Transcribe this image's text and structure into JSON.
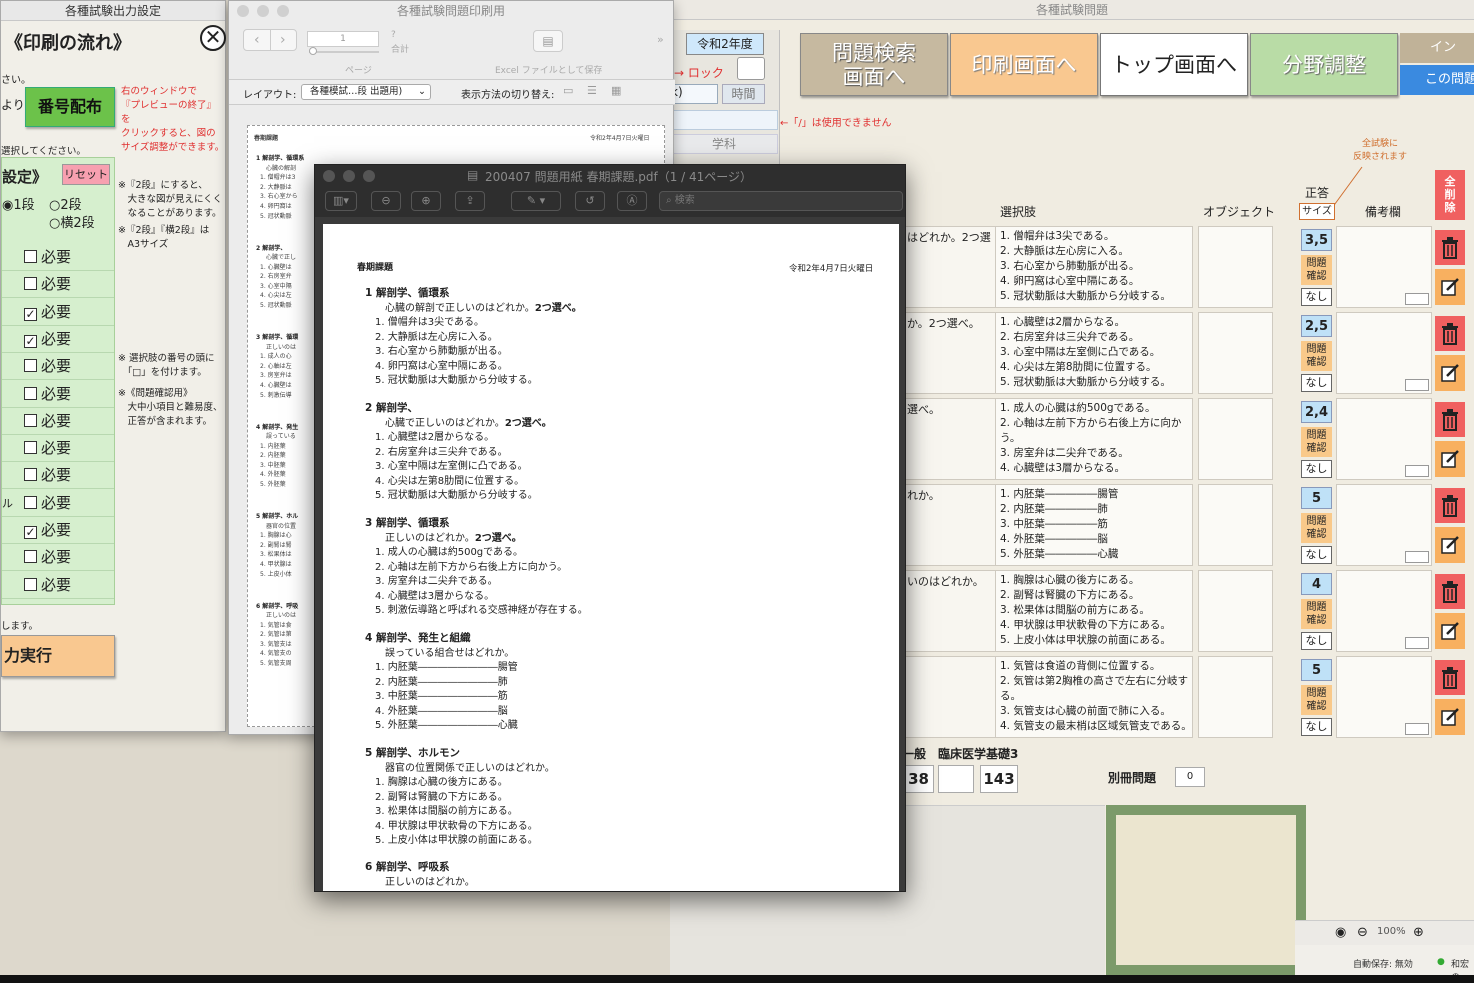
{
  "main_window": {
    "title": "各種試験問題",
    "buttons": {
      "search": "問題検索\n画面へ",
      "print": "印刷画面へ",
      "top": "トップ画面へ",
      "field": "分野調整",
      "partial_top": "イン",
      "partial_bottom": "この問題"
    },
    "year": "令和2年度",
    "lock_label": "ロック",
    "time_label": "時間",
    "subject_label": "学科",
    "partial_tab": "k)",
    "slash_warning": "←「/」は使用できません",
    "all_exam_note": "全試験に\n反映されます",
    "columns": {
      "choices": "選択肢",
      "object": "オブジェクト",
      "answer": "正答",
      "size": "サイズ",
      "remarks": "備考欄",
      "delete_all": "全\n削\n除"
    },
    "confirm_label": "問題\n確認",
    "none_label": "なし",
    "rows": [
      {
        "q": "はどれか。2つ選",
        "choices": [
          "1. 僧帽弁は3尖である。",
          "2. 大静脈は左心房に入る。",
          "3. 右心室から肺動脈が出る。",
          "4. 卵円窩は心室中隔にある。",
          "5. 冠状動脈は大動脈から分岐する。"
        ],
        "answer": "3,5"
      },
      {
        "q": "か。2つ選べ。",
        "choices": [
          "1. 心臓壁は2層からなる。",
          "2. 右房室弁は三尖弁である。",
          "3. 心室中隔は左室側に凸である。",
          "4. 心尖は左第8肋間に位置する。",
          "5. 冠状動脈は大動脈から分岐する。"
        ],
        "answer": "2,5"
      },
      {
        "q": "選べ。",
        "choices": [
          "1. 成人の心臓は約500gである。",
          "2. 心軸は左前下方から右後上方に向か",
          "う。",
          "3. 房室弁は二尖弁である。",
          "4. 心臓壁は3層からなる。"
        ],
        "answer": "2,4"
      },
      {
        "q": "れか。",
        "choices": [
          "1. 内胚葉―――――腸管",
          "2. 内胚葉―――――肺",
          "3. 中胚葉―――――筋",
          "4. 外胚葉―――――脳",
          "5. 外胚葉―――――心臓"
        ],
        "answer": "5"
      },
      {
        "q": "いのはどれか。",
        "choices": [
          "1. 胸腺は心臓の後方にある。",
          "2. 副腎は腎臓の下方にある。",
          "3. 松果体は間脳の前方にある。",
          "4. 甲状腺は甲状軟骨の下方にある。",
          "5. 上皮小体は甲状腺の前面にある。"
        ],
        "answer": "4"
      },
      {
        "q": "",
        "choices": [
          "1. 気管は食道の背側に位置する。",
          "2. 気管は第2胸椎の高さで左右に分岐す",
          "る。",
          "3. 気管支は心臓の前面で肺に入る。",
          "4. 気管支の最末梢は区域気管支である。"
        ],
        "answer": "5"
      }
    ],
    "footer": {
      "category_prefix": "一般",
      "category": "臨床医学基礎3",
      "num1": "38",
      "num2": "",
      "num3": "143",
      "extra_label": "別冊問題",
      "extra_value": "0"
    },
    "status": {
      "zoom": "100%",
      "autosave": "自動保存: 無効",
      "user": "和宏の"
    }
  },
  "left_window": {
    "title": "各種試験出力設定",
    "heading": "《印刷の流れ》",
    "text1": "さい。",
    "assign_prefix": "より",
    "assign_button": "番号配布",
    "red_note": "右のウィンドウで\n『プレビューの終了』を\nクリックすると、図の\nサイズ調整ができます。",
    "select_text": "選択してください。",
    "section_label": "設定》",
    "reset": "リセット",
    "radio_1": "1段",
    "radio_2": "2段",
    "radio_3": "横2段",
    "note1": "※『2段』にすると、\n　大きな図が見えにくく\n　なることがあります。",
    "note2": "※『2段』『横2段』は\n　A3サイズ",
    "note3": "※ 選択肢の番号の頭に\n　「□」を付けます。",
    "note4": "※《問題確認用》\n　大中小項目と難易度、\n　正答が含まれます。",
    "need_label": "必要",
    "checks": [
      false,
      false,
      true,
      true,
      false,
      false,
      false,
      false,
      false,
      false,
      true,
      false,
      false
    ],
    "row_prefix": [
      "",
      "",
      "",
      "",
      "",
      "",
      "",
      "",
      "",
      "ル",
      "",
      "",
      ""
    ],
    "bottom_text": "します。",
    "exec_button": "力実行"
  },
  "print_window": {
    "title": "各種試験問題印刷用",
    "page_value": "1",
    "page_total": "?",
    "total_label": "合計",
    "page_label": "ページ",
    "excel_label": "Excel ファイルとして保存",
    "layout_label": "レイアウト:",
    "layout_value": "各種模試…段 出題用)",
    "view_label": "表示方法の切り替え:",
    "preview_header_left": "春期課題",
    "preview_header_right": "令和2年4月7日火曜日",
    "preview": [
      [
        "1 解剖学、循環系",
        "心臓の解剖",
        "1. 僧帽弁は3",
        "2. 大静脈は",
        "3. 右心室から",
        "4. 卵円窩は",
        "5. 冠状動脈"
      ],
      [
        "2 解剖学、",
        "心臓で正し",
        "1. 心臓壁は",
        "2. 右房室弁",
        "3. 心室中隔",
        "4. 心尖は左",
        "5. 冠状動脈"
      ],
      [
        "3 解剖学、循環",
        "正しいのは",
        "1. 成人の心",
        "2. 心軸は左",
        "3. 房室弁は",
        "4. 心臓壁は",
        "5. 刺激伝導"
      ],
      [
        "4 解剖学、発生",
        "誤っている",
        "1. 内胚葉",
        "2. 内胚葉",
        "3. 中胚葉",
        "4. 外胚葉",
        "5. 外胚葉"
      ],
      [
        "5 解剖学、ホル",
        "器官の位置",
        "1. 胸腺は心",
        "2. 副腎は腎",
        "3. 松果体は",
        "4. 甲状腺は",
        "5. 上皮小体"
      ],
      [
        "6 解剖学、呼吸",
        "正しいのは",
        "1. 気管は食",
        "2. 気管は第",
        "3. 気管支は",
        "4. 気管支の",
        "5. 気管支周"
      ]
    ]
  },
  "pdf_window": {
    "title": "200407 問題用紙 春期課題.pdf（1 / 41ページ）",
    "search_placeholder": "検索",
    "header_left": "春期課題",
    "header_right": "令和2年4月7日火曜日",
    "questions": [
      {
        "h": "1 解剖学、循環系",
        "s": "心臓の解剖で正しいのはどれか。",
        "b": "2つ選べ。",
        "c": [
          "1. 僧帽弁は3尖である。",
          "2. 大静脈は左心房に入る。",
          "3. 右心室から肺動脈が出る。",
          "4. 卵円窩は心室中隔にある。",
          "5. 冠状動脈は大動脈から分岐する。"
        ]
      },
      {
        "h": "2 解剖学、",
        "s": "心臓で正しいのはどれか。",
        "b": "2つ選べ。",
        "c": [
          "1. 心臓壁は2層からなる。",
          "2. 右房室弁は三尖弁である。",
          "3. 心室中隔は左室側に凸である。",
          "4. 心尖は左第8肋間に位置する。",
          "5. 冠状動脈は大動脈から分岐する。"
        ]
      },
      {
        "h": "3 解剖学、循環系",
        "s": "正しいのはどれか。",
        "b": "2つ選べ。",
        "c": [
          "1. 成人の心臓は約500gである。",
          "2. 心軸は左前下方から右後上方に向かう。",
          "3. 房室弁は二尖弁である。",
          "4. 心臓壁は3層からなる。",
          "5. 刺激伝導路と呼ばれる交感神経が存在する。"
        ]
      },
      {
        "h": "4 解剖学、発生と組織",
        "s": "誤っている組合せはどれか。",
        "b": "",
        "c": [
          "1. 内胚葉――――――――腸管",
          "2. 内胚葉――――――――肺",
          "3. 中胚葉――――――――筋",
          "4. 外胚葉――――――――脳",
          "5. 外胚葉――――――――心臓"
        ]
      },
      {
        "h": "5 解剖学、ホルモン",
        "s": "器官の位置関係で正しいのはどれか。",
        "b": "",
        "c": [
          "1. 胸腺は心臓の後方にある。",
          "2. 副腎は腎臓の下方にある。",
          "3. 松果体は間脳の前方にある。",
          "4. 甲状腺は甲状軟骨の下方にある。",
          "5. 上皮小体は甲状腺の前面にある。"
        ]
      },
      {
        "h": "6 解剖学、呼吸系",
        "s": "正しいのはどれか。",
        "b": "",
        "c": []
      }
    ]
  }
}
